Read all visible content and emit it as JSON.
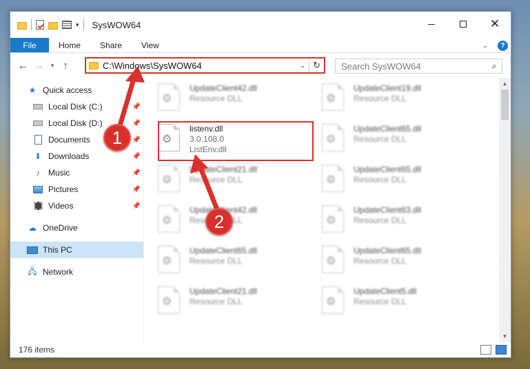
{
  "window": {
    "title": "SysWOW64"
  },
  "ribbon": {
    "tabs": [
      "File",
      "Home",
      "Share",
      "View"
    ]
  },
  "address": {
    "path": "C:\\Windows\\SysWOW64"
  },
  "search": {
    "placeholder": "Search SysWOW64"
  },
  "nav": {
    "items": [
      {
        "label": "Quick access"
      },
      {
        "label": "Local Disk (C:)"
      },
      {
        "label": "Local Disk (D:)"
      },
      {
        "label": "Documents"
      },
      {
        "label": "Downloads"
      },
      {
        "label": "Music"
      },
      {
        "label": "Pictures"
      },
      {
        "label": "Videos"
      },
      {
        "label": "OneDrive"
      },
      {
        "label": "This PC"
      },
      {
        "label": "Network"
      }
    ]
  },
  "files": [
    {
      "name": "UpdateClient42.dll",
      "line1": "Resource DLL",
      "line2": ""
    },
    {
      "name": "UpdateClient19.dll",
      "line1": "Resource DLL",
      "line2": ""
    },
    {
      "name": "listenv.dll",
      "line1": "3.0.108.0",
      "line2": "ListEnv.dll"
    },
    {
      "name": "UpdateClient65.dll",
      "line1": "Resource DLL",
      "line2": ""
    },
    {
      "name": "UpdateClient21.dll",
      "line1": "Resource DLL",
      "line2": ""
    },
    {
      "name": "UpdateClient65.dll",
      "line1": "Resource DLL",
      "line2": ""
    },
    {
      "name": "UpdateClient42.dll",
      "line1": "Resource DLL",
      "line2": ""
    },
    {
      "name": "UpdateClient63.dll",
      "line1": "Resource DLL",
      "line2": ""
    },
    {
      "name": "UpdateClient65.dll",
      "line1": "Resource DLL",
      "line2": ""
    },
    {
      "name": "UpdateClient65.dll",
      "line1": "Resource DLL",
      "line2": ""
    },
    {
      "name": "UpdateClient21.dll",
      "line1": "Resource DLL",
      "line2": ""
    },
    {
      "name": "UpdateClient5.dll",
      "line1": "Resource DLL",
      "line2": ""
    }
  ],
  "status": {
    "count": "176 items"
  },
  "callouts": {
    "one": "1",
    "two": "2"
  },
  "colors": {
    "accent": "#1979ca",
    "highlight": "#d9302c",
    "selection": "#cce4f7"
  }
}
